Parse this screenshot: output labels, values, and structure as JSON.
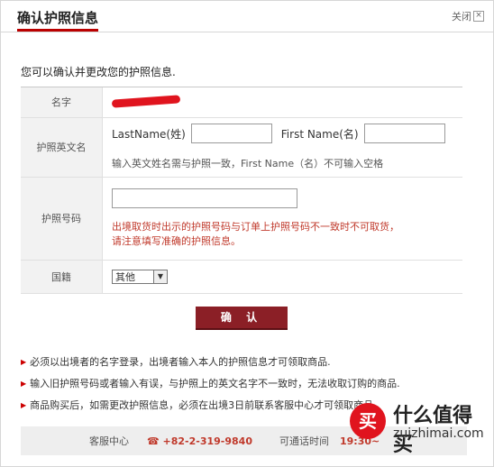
{
  "tab": {
    "title": "确认护照信息"
  },
  "close_label": "关闭",
  "intro": "您可以确认并更改您的护照信息.",
  "rows": {
    "name_label": "名字",
    "english_label": "护照英文名",
    "lastname_label": "LastName(姓)",
    "firstname_label": "First Name(名)",
    "english_hint": "输入英文姓名需与护照一致，First Name（名）不可输入空格",
    "passport_label": "护照号码",
    "passport_warn_1": "出境取货时出示的护照号码与订单上护照号码不一致时不可取货，",
    "passport_warn_2": "请注意填写准确的护照信息。",
    "country_label": "国籍",
    "country_value": "其他"
  },
  "confirm_label": "确 认",
  "notes": [
    "必须以出境者的名字登录，出境者输入本人的护照信息才可领取商品.",
    "输入旧护照号码或者输入有误，与护照上的英文名字不一致时，无法收取订购的商品.",
    "商品购买后，如需更改护照信息，必须在出境3日前联系客服中心才可领取商品."
  ],
  "footer": {
    "service_label": "客服中心",
    "phone": "☎ +82-2-319-9840",
    "hours_label": "可通话时间",
    "hours": "19:30~"
  },
  "watermark": {
    "badge": "买",
    "title": "什么值得买",
    "url": "zuizhimai.com"
  },
  "colors": {
    "accent": "#8b1f26",
    "warn": "#c0392b",
    "redaction": "#e0141e"
  }
}
